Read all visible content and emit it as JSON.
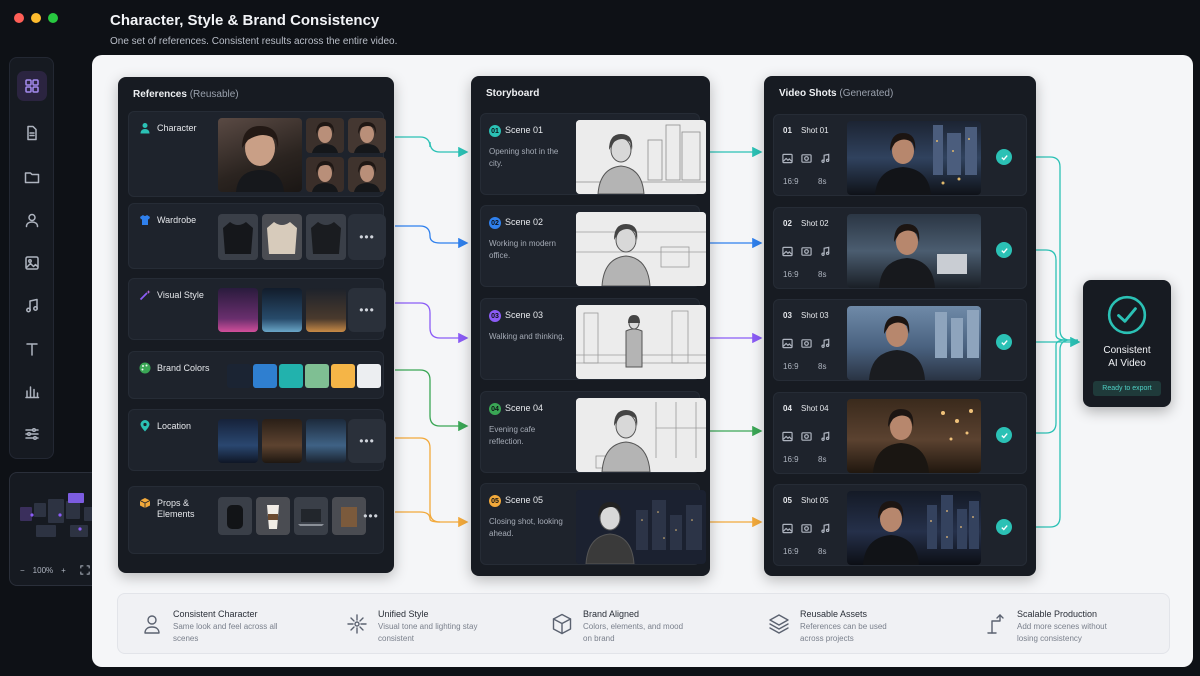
{
  "window": {
    "title": "Character, Style & Brand Consistency",
    "subtitle": "One set of references. Consistent results across the entire video."
  },
  "colors": {
    "teal": "#2bc1b5",
    "blue": "#2f80ed",
    "purple": "#8b5cf6",
    "green": "#3aa655",
    "amber": "#f2a93b"
  },
  "rail": {
    "items": [
      {
        "icon": "grid-icon",
        "active": true
      },
      {
        "icon": "document-icon"
      },
      {
        "icon": "folder-icon"
      },
      {
        "icon": "user-icon"
      },
      {
        "icon": "image-icon"
      },
      {
        "icon": "music-icon"
      },
      {
        "icon": "text-icon"
      },
      {
        "icon": "chart-icon"
      },
      {
        "icon": "sliders-icon"
      }
    ]
  },
  "minimap": {
    "zoom": "100%",
    "minus": "−",
    "plus": "+"
  },
  "references": {
    "title": "References",
    "title_note": "(Reusable)",
    "rows": [
      {
        "label": "Character",
        "icon": "person-icon"
      },
      {
        "label": "Wardrobe",
        "icon": "shirt-icon"
      },
      {
        "label": "Visual Style",
        "icon": "wand-icon"
      },
      {
        "label": "Brand Colors",
        "icon": "palette-icon"
      },
      {
        "label": "Location",
        "icon": "pin-icon"
      },
      {
        "label": "Props & Elements",
        "icon": "box-icon"
      }
    ],
    "brand_swatches": [
      "#1b2433",
      "#2f7fd0",
      "#22b2ad",
      "#7fbf93",
      "#f5b547",
      "#eceef1"
    ],
    "more": "•••"
  },
  "storyboard": {
    "title": "Storyboard",
    "scenes": [
      {
        "num": "01",
        "name": "Scene 01",
        "desc": "Opening shot in the city."
      },
      {
        "num": "02",
        "name": "Scene 02",
        "desc": "Working in modern office."
      },
      {
        "num": "03",
        "name": "Scene 03",
        "desc": "Walking and thinking."
      },
      {
        "num": "04",
        "name": "Scene 04",
        "desc": "Evening cafe reflection."
      },
      {
        "num": "05",
        "name": "Scene 05",
        "desc": "Closing shot, looking ahead."
      }
    ]
  },
  "video_shots": {
    "title": "Video Shots",
    "title_note": "(Generated)",
    "shots": [
      {
        "num": "01",
        "name": "Shot 01",
        "ratio": "16:9",
        "duration": "8s"
      },
      {
        "num": "02",
        "name": "Shot 02",
        "ratio": "16:9",
        "duration": "8s"
      },
      {
        "num": "03",
        "name": "Shot 03",
        "ratio": "16:9",
        "duration": "8s"
      },
      {
        "num": "04",
        "name": "Shot 04",
        "ratio": "16:9",
        "duration": "8s"
      },
      {
        "num": "05",
        "name": "Shot 05",
        "ratio": "16:9",
        "duration": "8s"
      }
    ]
  },
  "final": {
    "title_line1": "Consistent",
    "title_line2": "AI Video",
    "status": "Ready to export"
  },
  "features": [
    {
      "icon": "person-outline-icon",
      "title": "Consistent Character",
      "desc": "Same look and feel across all scenes"
    },
    {
      "icon": "sparkle-icon",
      "title": "Unified Style",
      "desc": "Visual tone and lighting stay consistent"
    },
    {
      "icon": "cube-icon",
      "title": "Brand Aligned",
      "desc": "Colors, elements, and mood on brand"
    },
    {
      "icon": "layers-icon",
      "title": "Reusable Assets",
      "desc": "References can be used across projects"
    },
    {
      "icon": "scale-icon",
      "title": "Scalable Production",
      "desc": "Add more scenes without losing consistency"
    }
  ]
}
